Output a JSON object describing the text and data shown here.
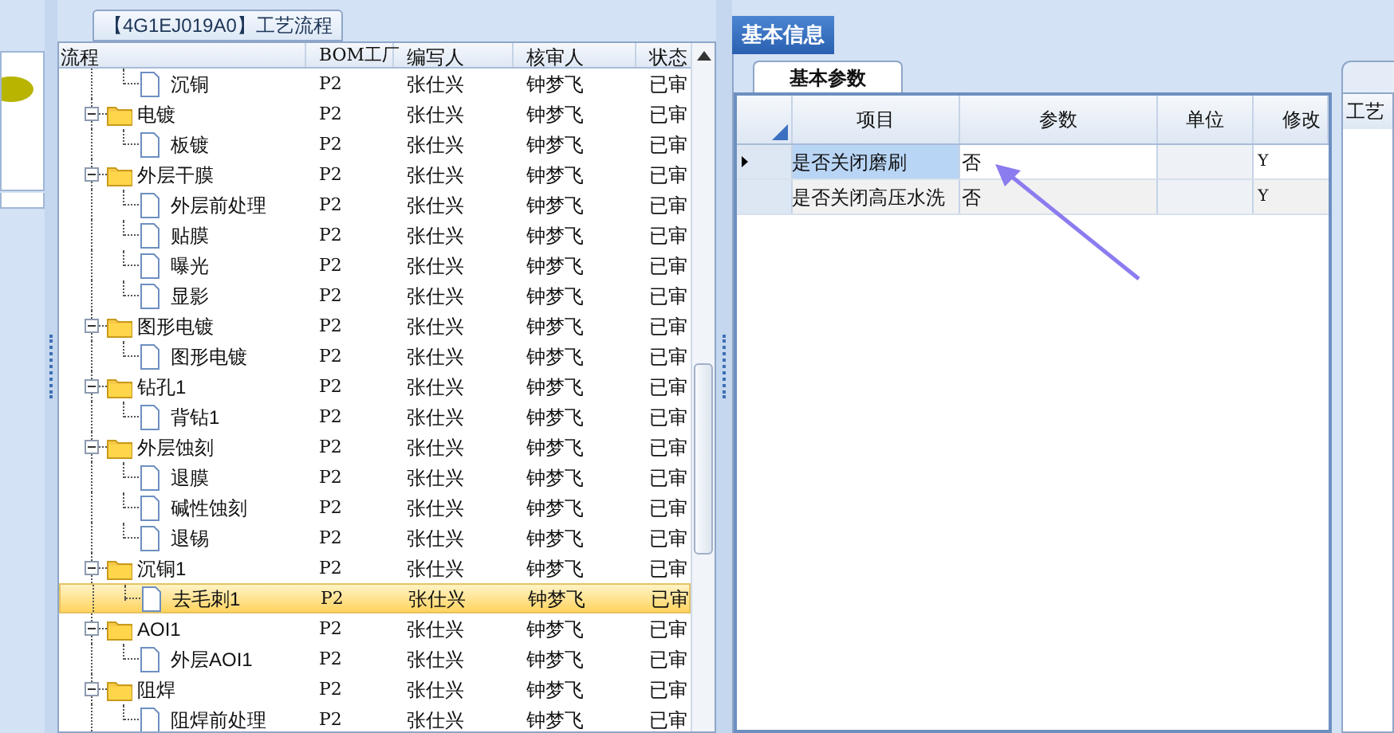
{
  "process_panel": {
    "title": "【4G1EJ019A0】工艺流程",
    "columns": [
      "流程",
      "BOM工厂",
      "编写人",
      "核审人",
      "状态"
    ],
    "continued": [
      {
        "name": "沉铜",
        "bom": "P2",
        "author": "张仕兴",
        "reviewer": "钟梦飞",
        "status": "已审",
        "selected": false
      }
    ],
    "nodes": [
      {
        "name": "电镀",
        "bom": "P2",
        "author": "张仕兴",
        "reviewer": "钟梦飞",
        "status": "已审",
        "selected": false,
        "expanded": true,
        "children": [
          {
            "name": "板镀",
            "bom": "P2",
            "author": "张仕兴",
            "reviewer": "钟梦飞",
            "status": "已审",
            "selected": false
          }
        ]
      },
      {
        "name": "外层干膜",
        "bom": "P2",
        "author": "张仕兴",
        "reviewer": "钟梦飞",
        "status": "已审",
        "selected": false,
        "expanded": true,
        "children": [
          {
            "name": "外层前处理",
            "bom": "P2",
            "author": "张仕兴",
            "reviewer": "钟梦飞",
            "status": "已审",
            "selected": false
          },
          {
            "name": "贴膜",
            "bom": "P2",
            "author": "张仕兴",
            "reviewer": "钟梦飞",
            "status": "已审",
            "selected": false
          },
          {
            "name": "曝光",
            "bom": "P2",
            "author": "张仕兴",
            "reviewer": "钟梦飞",
            "status": "已审",
            "selected": false
          },
          {
            "name": "显影",
            "bom": "P2",
            "author": "张仕兴",
            "reviewer": "钟梦飞",
            "status": "已审",
            "selected": false
          }
        ]
      },
      {
        "name": "图形电镀",
        "bom": "P2",
        "author": "张仕兴",
        "reviewer": "钟梦飞",
        "status": "已审",
        "selected": false,
        "expanded": true,
        "children": [
          {
            "name": "图形电镀",
            "bom": "P2",
            "author": "张仕兴",
            "reviewer": "钟梦飞",
            "status": "已审",
            "selected": false
          }
        ]
      },
      {
        "name": "钻孔1",
        "bom": "P2",
        "author": "张仕兴",
        "reviewer": "钟梦飞",
        "status": "已审",
        "selected": false,
        "expanded": true,
        "children": [
          {
            "name": "背钻1",
            "bom": "P2",
            "author": "张仕兴",
            "reviewer": "钟梦飞",
            "status": "已审",
            "selected": false
          }
        ]
      },
      {
        "name": "外层蚀刻",
        "bom": "P2",
        "author": "张仕兴",
        "reviewer": "钟梦飞",
        "status": "已审",
        "selected": false,
        "expanded": true,
        "children": [
          {
            "name": "退膜",
            "bom": "P2",
            "author": "张仕兴",
            "reviewer": "钟梦飞",
            "status": "已审",
            "selected": false
          },
          {
            "name": "碱性蚀刻",
            "bom": "P2",
            "author": "张仕兴",
            "reviewer": "钟梦飞",
            "status": "已审",
            "selected": false
          },
          {
            "name": "退锡",
            "bom": "P2",
            "author": "张仕兴",
            "reviewer": "钟梦飞",
            "status": "已审",
            "selected": false
          }
        ]
      },
      {
        "name": "沉铜1",
        "bom": "P2",
        "author": "张仕兴",
        "reviewer": "钟梦飞",
        "status": "已审",
        "selected": false,
        "expanded": true,
        "children": [
          {
            "name": "去毛刺1",
            "bom": "P2",
            "author": "张仕兴",
            "reviewer": "钟梦飞",
            "status": "已审",
            "selected": true
          }
        ]
      },
      {
        "name": "AOI1",
        "bom": "P2",
        "author": "张仕兴",
        "reviewer": "钟梦飞",
        "status": "已审",
        "selected": false,
        "expanded": true,
        "children": [
          {
            "name": "外层AOI1",
            "bom": "P2",
            "author": "张仕兴",
            "reviewer": "钟梦飞",
            "status": "已审",
            "selected": false
          }
        ]
      },
      {
        "name": "阻焊",
        "bom": "P2",
        "author": "张仕兴",
        "reviewer": "钟梦飞",
        "status": "已审",
        "selected": false,
        "expanded": true,
        "children": [
          {
            "name": "阻焊前处理",
            "bom": "P2",
            "author": "张仕兴",
            "reviewer": "钟梦飞",
            "status": "已审",
            "selected": false
          }
        ]
      }
    ]
  },
  "info_panel": {
    "tabs": [
      {
        "label": "基本信息",
        "selected": true
      }
    ],
    "subtabs": [
      {
        "label": "基本参数",
        "selected": true
      }
    ],
    "columns": [
      "项目",
      "参数",
      "单位",
      "修改"
    ],
    "rows": [
      {
        "item": "是否关闭磨刷",
        "value": "否",
        "unit": "",
        "modified": "Y",
        "selected": true
      },
      {
        "item": "是否关闭高压水洗",
        "value": "否",
        "unit": "",
        "modified": "Y",
        "selected": false
      }
    ],
    "side_header": "工艺"
  }
}
